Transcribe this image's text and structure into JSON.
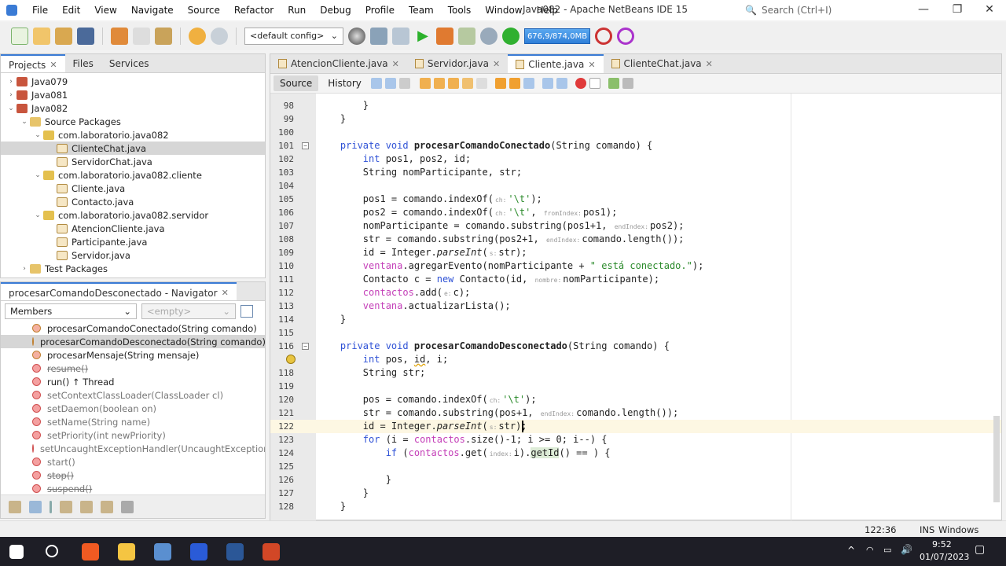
{
  "window": {
    "title": "Java082 - Apache NetBeans IDE 15",
    "search_placeholder": "Search (Ctrl+I)"
  },
  "menu": [
    "File",
    "Edit",
    "View",
    "Navigate",
    "Source",
    "Refactor",
    "Run",
    "Debug",
    "Profile",
    "Team",
    "Tools",
    "Window",
    "Help"
  ],
  "toolbar": {
    "config": "<default config>",
    "memory": "676,9/874,0MB"
  },
  "projects_panel": {
    "tabs": [
      "Projects",
      "Files",
      "Services"
    ],
    "tree": [
      {
        "label": "Java079",
        "depth": 0,
        "arrow": "›",
        "icon": "project"
      },
      {
        "label": "Java081",
        "depth": 0,
        "arrow": "›",
        "icon": "project"
      },
      {
        "label": "Java082",
        "depth": 0,
        "arrow": "⌄",
        "icon": "project"
      },
      {
        "label": "Source Packages",
        "depth": 1,
        "arrow": "⌄",
        "icon": "folder"
      },
      {
        "label": "com.laboratorio.java082",
        "depth": 2,
        "arrow": "⌄",
        "icon": "package"
      },
      {
        "label": "ClienteChat.java",
        "depth": 3,
        "arrow": "",
        "icon": "java",
        "selected": true
      },
      {
        "label": "ServidorChat.java",
        "depth": 3,
        "arrow": "",
        "icon": "java"
      },
      {
        "label": "com.laboratorio.java082.cliente",
        "depth": 2,
        "arrow": "⌄",
        "icon": "package"
      },
      {
        "label": "Cliente.java",
        "depth": 3,
        "arrow": "",
        "icon": "java"
      },
      {
        "label": "Contacto.java",
        "depth": 3,
        "arrow": "",
        "icon": "java"
      },
      {
        "label": "com.laboratorio.java082.servidor",
        "depth": 2,
        "arrow": "⌄",
        "icon": "package"
      },
      {
        "label": "AtencionCliente.java",
        "depth": 3,
        "arrow": "",
        "icon": "java"
      },
      {
        "label": "Participante.java",
        "depth": 3,
        "arrow": "",
        "icon": "java"
      },
      {
        "label": "Servidor.java",
        "depth": 3,
        "arrow": "",
        "icon": "java"
      },
      {
        "label": "Test Packages",
        "depth": 1,
        "arrow": "›",
        "icon": "folder"
      }
    ]
  },
  "navigator": {
    "title": "procesarComandoDesconectado - Navigator",
    "filter": "Members",
    "second_filter": "<empty>",
    "items": [
      {
        "label": "procesarComandoConectado(String comando)",
        "style": "private"
      },
      {
        "label": "procesarComandoDesconectado(String comando)",
        "style": "private",
        "selected": true
      },
      {
        "label": "procesarMensaje(String mensaje)",
        "style": "private"
      },
      {
        "label": "resume()",
        "style": "deprecated"
      },
      {
        "label": "run() ↑ Thread",
        "style": "normal"
      },
      {
        "label": "setContextClassLoader(ClassLoader cl)",
        "style": "inherited"
      },
      {
        "label": "setDaemon(boolean on)",
        "style": "inherited"
      },
      {
        "label": "setName(String name)",
        "style": "inherited"
      },
      {
        "label": "setPriority(int newPriority)",
        "style": "inherited"
      },
      {
        "label": "setUncaughtExceptionHandler(UncaughtExceptionHandler eh)",
        "style": "inherited"
      },
      {
        "label": "start()",
        "style": "inherited"
      },
      {
        "label": "stop()",
        "style": "deprecated"
      },
      {
        "label": "suspend()",
        "style": "deprecated"
      }
    ]
  },
  "editor": {
    "tabs": [
      {
        "label": "AtencionCliente.java"
      },
      {
        "label": "Servidor.java"
      },
      {
        "label": "Cliente.java",
        "active": true
      },
      {
        "label": "ClienteChat.java"
      }
    ],
    "source_label": "Source",
    "history_label": "History",
    "lines": [
      {
        "n": "98",
        "s": [
          [
            "p",
            "        }"
          ]
        ]
      },
      {
        "n": "99",
        "s": [
          [
            "p",
            "    }"
          ]
        ]
      },
      {
        "n": "100",
        "s": []
      },
      {
        "n": "101",
        "fold": true,
        "s": [
          [
            "p",
            "    "
          ],
          [
            "k",
            "private void "
          ],
          [
            "b",
            "procesarComandoConectado"
          ],
          [
            "p",
            "(String comando) {"
          ]
        ]
      },
      {
        "n": "102",
        "s": [
          [
            "p",
            "        "
          ],
          [
            "k",
            "int"
          ],
          [
            "p",
            " pos1, pos2, id;"
          ]
        ]
      },
      {
        "n": "103",
        "s": [
          [
            "p",
            "        String nomParticipante, str;"
          ]
        ]
      },
      {
        "n": "104",
        "s": []
      },
      {
        "n": "105",
        "s": [
          [
            "p",
            "        pos1 = comando.indexOf("
          ],
          [
            "h",
            "ch:"
          ],
          [
            "s",
            "'\\t'"
          ],
          [
            "p",
            ");"
          ]
        ]
      },
      {
        "n": "106",
        "s": [
          [
            "p",
            "        pos2 = comando.indexOf("
          ],
          [
            "h",
            "ch:"
          ],
          [
            "s",
            "'\\t'"
          ],
          [
            "p",
            ", "
          ],
          [
            "h",
            "fromIndex:"
          ],
          [
            "p",
            "pos1);"
          ]
        ]
      },
      {
        "n": "107",
        "s": [
          [
            "p",
            "        nomParticipante = comando.substring(pos1+1, "
          ],
          [
            "h",
            "endIndex:"
          ],
          [
            "p",
            "pos2);"
          ]
        ]
      },
      {
        "n": "108",
        "s": [
          [
            "p",
            "        str = comando.substring(pos2+1, "
          ],
          [
            "h",
            "endIndex:"
          ],
          [
            "p",
            "comando.length());"
          ]
        ]
      },
      {
        "n": "109",
        "s": [
          [
            "p",
            "        id = Integer."
          ],
          [
            "i",
            "parseInt"
          ],
          [
            "p",
            "("
          ],
          [
            "h",
            "s:"
          ],
          [
            "p",
            "str);"
          ]
        ]
      },
      {
        "n": "110",
        "s": [
          [
            "p",
            "        "
          ],
          [
            "f",
            "ventana"
          ],
          [
            "p",
            ".agregarEvento(nomParticipante + "
          ],
          [
            "s",
            "\" está conectado.\""
          ],
          [
            "p",
            ");"
          ]
        ]
      },
      {
        "n": "111",
        "s": [
          [
            "p",
            "        Contacto c = "
          ],
          [
            "k",
            "new"
          ],
          [
            "p",
            " Contacto(id, "
          ],
          [
            "h",
            "nombre:"
          ],
          [
            "p",
            "nomParticipante);"
          ]
        ]
      },
      {
        "n": "112",
        "s": [
          [
            "p",
            "        "
          ],
          [
            "f",
            "contactos"
          ],
          [
            "p",
            ".add("
          ],
          [
            "h",
            "e:"
          ],
          [
            "p",
            "c);"
          ]
        ]
      },
      {
        "n": "113",
        "s": [
          [
            "p",
            "        "
          ],
          [
            "f",
            "ventana"
          ],
          [
            "p",
            ".actualizarLista();"
          ]
        ]
      },
      {
        "n": "114",
        "s": [
          [
            "p",
            "    }"
          ]
        ]
      },
      {
        "n": "115",
        "s": []
      },
      {
        "n": "116",
        "fold": true,
        "s": [
          [
            "p",
            "    "
          ],
          [
            "k",
            "private void "
          ],
          [
            "b",
            "procesarComandoDesconectado"
          ],
          [
            "p",
            "(String comando) {"
          ]
        ]
      },
      {
        "n": "117",
        "bulb": true,
        "s": [
          [
            "p",
            "        "
          ],
          [
            "k",
            "int"
          ],
          [
            "p",
            " pos, "
          ],
          [
            "u",
            "id"
          ],
          [
            "p",
            ", i;"
          ]
        ]
      },
      {
        "n": "118",
        "s": [
          [
            "p",
            "        String str;"
          ]
        ]
      },
      {
        "n": "119",
        "s": []
      },
      {
        "n": "120",
        "s": [
          [
            "p",
            "        pos = comando.indexOf("
          ],
          [
            "h",
            "ch:"
          ],
          [
            "s",
            "'\\t'"
          ],
          [
            "p",
            ");"
          ]
        ]
      },
      {
        "n": "121",
        "s": [
          [
            "p",
            "        str = comando.substring(pos+1, "
          ],
          [
            "h",
            "endIndex:"
          ],
          [
            "p",
            "comando.length());"
          ]
        ]
      },
      {
        "n": "122",
        "current": true,
        "s": [
          [
            "p",
            "        id = Integer."
          ],
          [
            "i",
            "parseInt"
          ],
          [
            "p",
            "("
          ],
          [
            "h",
            "s:"
          ],
          [
            "p",
            "str);"
          ]
        ]
      },
      {
        "n": "123",
        "s": [
          [
            "p",
            "        "
          ],
          [
            "k",
            "for"
          ],
          [
            "p",
            " (i = "
          ],
          [
            "f",
            "contactos"
          ],
          [
            "p",
            ".size()-1; i >= 0; i--) {"
          ]
        ]
      },
      {
        "n": "124",
        "s": [
          [
            "p",
            "            "
          ],
          [
            "k",
            "if"
          ],
          [
            "p",
            " ("
          ],
          [
            "f",
            "contactos"
          ],
          [
            "p",
            ".get("
          ],
          [
            "h",
            "index:"
          ],
          [
            "p",
            "i)."
          ],
          [
            "g",
            "getId"
          ],
          [
            "p",
            "() == ) {"
          ]
        ]
      },
      {
        "n": "125",
        "s": []
      },
      {
        "n": "126",
        "s": [
          [
            "p",
            "            }"
          ]
        ]
      },
      {
        "n": "127",
        "s": [
          [
            "p",
            "        }"
          ]
        ]
      },
      {
        "n": "128",
        "s": [
          [
            "p",
            "    }"
          ]
        ]
      }
    ]
  },
  "status": {
    "position": "122:36",
    "mode": "INS",
    "line_endings": "Windows (CRLF)"
  },
  "taskbar": {
    "time": "9:52",
    "date": "01/07/2023"
  },
  "colors": {
    "accent": "#3a7bd5",
    "keyword": "#2f52d6",
    "field": "#c43fb8",
    "string": "#2a8a2a",
    "current_line": "#fdf7e3"
  }
}
